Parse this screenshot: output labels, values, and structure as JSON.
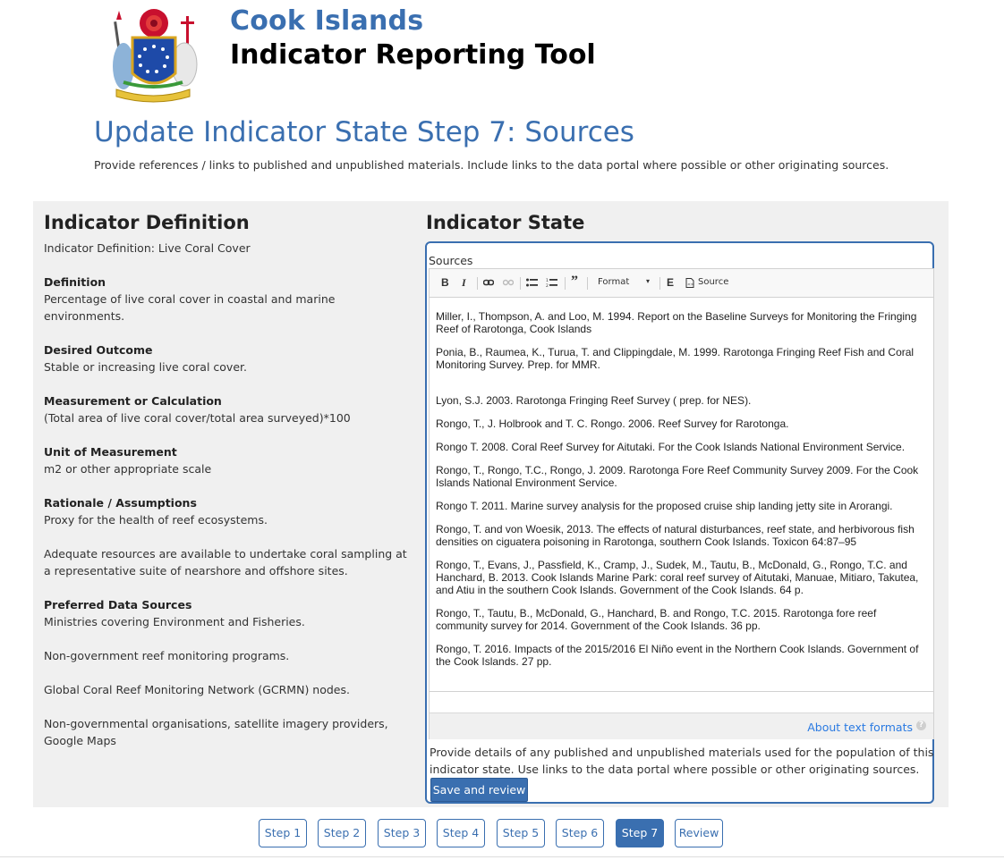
{
  "header": {
    "site_name": "Cook Islands",
    "site_slogan": "Indicator Reporting Tool",
    "logo_icon": "cook-islands-coat-of-arms"
  },
  "page": {
    "title": "Update Indicator State Step 7: Sources",
    "intro": "Provide references / links to published and unpublished materials. Include links to the data portal where possible or other originating sources."
  },
  "definition": {
    "heading": "Indicator Definition",
    "subtitle": "Indicator Definition: Live Coral Cover",
    "blocks": [
      {
        "head": "Definition",
        "lines": [
          "Percentage of live coral cover in coastal and marine environments."
        ]
      },
      {
        "head": "Desired Outcome",
        "lines": [
          "Stable or increasing live coral cover."
        ]
      },
      {
        "head": "Measurement or Calculation",
        "lines": [
          "(Total area of live coral cover/total area surveyed)*100"
        ]
      },
      {
        "head": "Unit of Measurement",
        "lines": [
          "m2 or other appropriate scale"
        ]
      },
      {
        "head": "Rationale / Assumptions",
        "lines": [
          "Proxy for the health of reef ecosystems."
        ]
      },
      {
        "head": "",
        "lines": [
          "Adequate resources are available to undertake coral sampling at a representative suite of nearshore and offshore sites."
        ]
      },
      {
        "head": "Preferred Data Sources",
        "lines": [
          "Ministries covering Environment and Fisheries."
        ]
      },
      {
        "head": "",
        "lines": [
          "Non-government reef monitoring programs."
        ]
      },
      {
        "head": "",
        "lines": [
          "Global Coral Reef Monitoring Network (GCRMN) nodes."
        ]
      },
      {
        "head": "",
        "lines": [
          "Non-governmental organisations, satellite imagery providers, Google Maps"
        ]
      }
    ]
  },
  "state": {
    "heading": "Indicator State",
    "sources_label": "Sources",
    "toolbar": {
      "bold": "B",
      "italic": "I",
      "format_label": "Format",
      "embed_label": "E",
      "source_label": "Source",
      "icons": [
        "bold-icon",
        "italic-icon",
        "link-icon",
        "unlink-icon",
        "bulleted-list-icon",
        "numbered-list-icon",
        "blockquote-icon",
        "format-dropdown",
        "embed-icon",
        "source-icon"
      ]
    },
    "sources": [
      "Miller, I., Thompson, A. and Loo, M. 1994. Report on the Baseline Surveys for Monitoring the Fringing Reef of Rarotonga, Cook Islands",
      "Ponia, B., Raumea, K., Turua, T. and Clippingdale, M. 1999. Rarotonga Fringing Reef Fish and Coral Monitoring Survey. Prep. for MMR.",
      "Lyon, S.J. 2003. Rarotonga Fringing Reef Survey ( prep. for NES).",
      "Rongo, T., J. Holbrook and T. C. Rongo. 2006. Reef Survey for Rarotonga.",
      "Rongo T. 2008. Coral Reef Survey for Aitutaki. For the Cook Islands National Environment Service.",
      "Rongo, T., Rongo, T.C., Rongo, J. 2009. Rarotonga Fore Reef Community Survey 2009. For the Cook Islands National Environment Service.",
      "Rongo T. 2011. Marine survey analysis for the proposed cruise ship landing jetty site in Arorangi.",
      "Rongo, T. and von Woesik, 2013. The effects of natural disturbances, reef state, and herbivorous fish densities on ciguatera poisoning in Rarotonga, southern Cook Islands. Toxicon 64:87–95",
      "Rongo, T., Evans, J., Passfield, K., Cramp, J., Sudek, M., Tautu, B., McDonald, G., Rongo, T.C. and Hanchard, B. 2013. Cook Islands Marine Park: coral reef survey of Aitutaki, Manuae, Mitiaro, Takutea, and Atiu in the southern Cook Islands. Government of the Cook Islands. 64 p.",
      "Rongo, T., Tautu, B., McDonald, G., Hanchard, B. and Rongo, T.C. 2015. Rarotonga fore reef community survey for 2014. Government of the Cook Islands. 36 pp.",
      "Rongo, T. 2016. Impacts of the 2015/2016 El Niño event in the Northern Cook Islands. Government of the Cook Islands. 27 pp."
    ],
    "formats_link": "About text formats",
    "help_text": "Provide details of any published and unpublished materials used for the population of this indicator state. Use links to the data portal where possible or other originating sources.",
    "save_label": "Save and review"
  },
  "steps": [
    {
      "label": "Step 1",
      "active": false
    },
    {
      "label": "Step 2",
      "active": false
    },
    {
      "label": "Step 3",
      "active": false
    },
    {
      "label": "Step 4",
      "active": false
    },
    {
      "label": "Step 5",
      "active": false
    },
    {
      "label": "Step 6",
      "active": false
    },
    {
      "label": "Step 7",
      "active": true
    },
    {
      "label": "Review",
      "active": false
    }
  ],
  "colors": {
    "brand": "#3a6fb0",
    "link": "#2a7ae2",
    "panel_bg": "#f0f0f0"
  }
}
